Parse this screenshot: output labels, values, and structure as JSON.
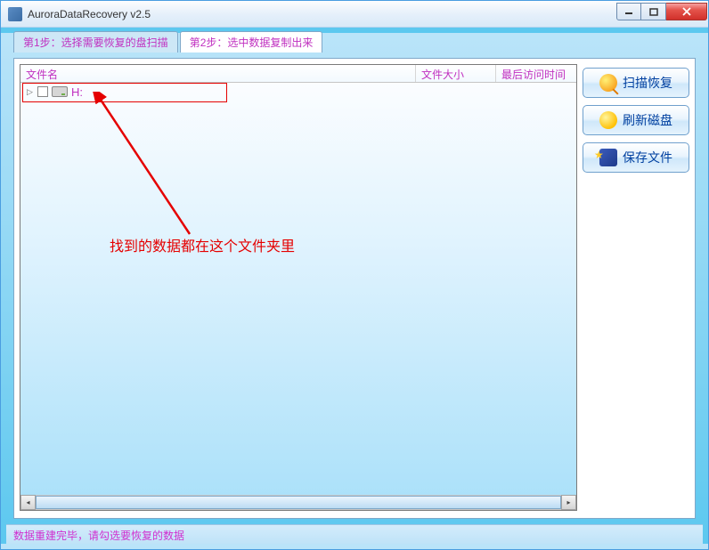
{
  "window": {
    "title": "AuroraDataRecovery v2.5"
  },
  "tabs": [
    {
      "label": "第1步：选择需要恢复的盘扫描",
      "active": false
    },
    {
      "label": "第2步：选中数据复制出来",
      "active": true
    }
  ],
  "columns": {
    "name": "文件名",
    "size": "文件大小",
    "time": "最后访问时间"
  },
  "rows": [
    {
      "label": "H:"
    }
  ],
  "annotation": "找到的数据都在这个文件夹里",
  "side_buttons": {
    "scan": "扫描恢复",
    "refresh": "刷新磁盘",
    "save": "保存文件"
  },
  "status": "数据重建完毕，请勾选要恢复的数据",
  "colors": {
    "magenta": "#c030c0",
    "red": "#e50000",
    "blue_text": "#0040a0"
  }
}
